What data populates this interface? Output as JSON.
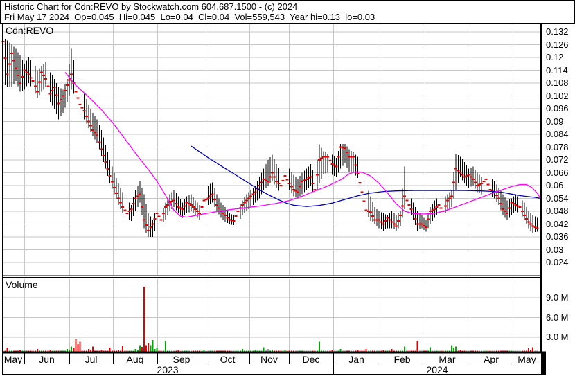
{
  "header": {
    "title": "Historic Chart for Cdn:REVO by Stockwatch.com 604.687.1500 - (c) 2024",
    "quote_line": "Fri May 17 2024  Op=0.045  Hi=0.045  Lo=0.04  Cl=0.04  Vol=559,543  Year hi=0.13  lo=0.03",
    "quote": {
      "date": "Fri May 17 2024",
      "open": "0.045",
      "high": "0.045",
      "low": "0.04",
      "close": "0.04",
      "volume": "559,543",
      "year_high": "0.13",
      "year_low": "0.03"
    }
  },
  "panes": {
    "symbol_label": "Cdn:REVO",
    "volume_label": "Volume"
  },
  "price_axis": {
    "labels": [
      "0.132",
      "0.126",
      "0.12",
      "0.114",
      "0.108",
      "0.102",
      "0.096",
      "0.09",
      "0.084",
      "0.078",
      "0.072",
      "0.066",
      "0.06",
      "0.054",
      "0.048",
      "0.042",
      "0.036",
      "0.03",
      "0.024"
    ],
    "max": 0.132,
    "step": 0.006
  },
  "volume_axis": {
    "labels": [
      "9.0 M",
      "6.0 M",
      "3.0 M"
    ],
    "values_millions": [
      9,
      6,
      3
    ]
  },
  "time_axis": {
    "months": [
      {
        "label": "May",
        "f0": 0.0,
        "f1": 0.0411
      },
      {
        "label": "Jun",
        "f0": 0.0411,
        "f1": 0.1247
      },
      {
        "label": "Jul",
        "f0": 0.1247,
        "f1": 0.2057
      },
      {
        "label": "Aug",
        "f0": 0.2057,
        "f1": 0.2879
      },
      {
        "label": "Sep",
        "f0": 0.2879,
        "f1": 0.3779
      },
      {
        "label": "Oct",
        "f0": 0.3779,
        "f1": 0.4589
      },
      {
        "label": "Nov",
        "f0": 0.4589,
        "f1": 0.5321
      },
      {
        "label": "Dec",
        "f0": 0.5321,
        "f1": 0.6144
      },
      {
        "label": "Jan",
        "f0": 0.6144,
        "f1": 0.7005
      },
      {
        "label": "Feb",
        "f0": 0.7005,
        "f1": 0.7841
      },
      {
        "label": "Mar",
        "f0": 0.7841,
        "f1": 0.8676
      },
      {
        "label": "Apr",
        "f0": 0.8676,
        "f1": 0.9473
      },
      {
        "label": "May",
        "f0": 0.9473,
        "f1": 1.0
      }
    ],
    "years": [
      {
        "label": "2023",
        "f0": 0.0,
        "f1": 0.6144
      },
      {
        "label": "2024",
        "f0": 0.6144,
        "f1": 1.0
      }
    ]
  },
  "colors": {
    "bar": "#000000",
    "close_tick": "#e80000",
    "ma_fast": "#ff00ff",
    "ma_slow": "#0000b8",
    "vol_up": "#00a800",
    "vol_down": "#e80000",
    "vol_flat": "#9c9c9c",
    "grid": "#c6c6c6",
    "text": "#000000",
    "bg": "#ffffff"
  },
  "chart_data": {
    "type": "ohlc+volume",
    "symbol": "Cdn:REVO",
    "title": "Historic Chart for Cdn:REVO",
    "period": "May 2023 - May 2024",
    "price_ylim": [
      0.024,
      0.132
    ],
    "volume_ylim_millions": [
      0,
      11.5
    ],
    "legend": "none",
    "grid": "on",
    "sampling_note": "high/low/close triplets read off the chart, one point per ~2 trading days",
    "bars_hlc": [
      [
        0.129,
        0.108,
        0.1275
      ],
      [
        0.128,
        0.106,
        0.112
      ],
      [
        0.126,
        0.106,
        0.122
      ],
      [
        0.124,
        0.109,
        0.115
      ],
      [
        0.121,
        0.104,
        0.108
      ],
      [
        0.117,
        0.105,
        0.114
      ],
      [
        0.12,
        0.108,
        0.112
      ],
      [
        0.118,
        0.105,
        0.109
      ],
      [
        0.114,
        0.101,
        0.104
      ],
      [
        0.116,
        0.104,
        0.113
      ],
      [
        0.118,
        0.106,
        0.11
      ],
      [
        0.113,
        0.099,
        0.103
      ],
      [
        0.11,
        0.096,
        0.106
      ],
      [
        0.106,
        0.091,
        0.0985
      ],
      [
        0.105,
        0.094,
        0.102
      ],
      [
        0.11,
        0.099,
        0.107
      ],
      [
        0.124,
        0.105,
        0.112
      ],
      [
        0.114,
        0.101,
        0.104
      ],
      [
        0.107,
        0.094,
        0.098
      ],
      [
        0.103,
        0.091,
        0.095
      ],
      [
        0.098,
        0.087,
        0.09
      ],
      [
        0.094,
        0.083,
        0.086
      ],
      [
        0.091,
        0.08,
        0.0835
      ],
      [
        0.086,
        0.074,
        0.077
      ],
      [
        0.079,
        0.068,
        0.071
      ],
      [
        0.072,
        0.061,
        0.0645
      ],
      [
        0.066,
        0.056,
        0.059
      ],
      [
        0.061,
        0.051,
        0.054
      ],
      [
        0.057,
        0.047,
        0.05
      ],
      [
        0.053,
        0.044,
        0.047
      ],
      [
        0.051,
        0.0435,
        0.049
      ],
      [
        0.058,
        0.048,
        0.054
      ],
      [
        0.062,
        0.052,
        0.056
      ],
      [
        0.056,
        0.04,
        0.044
      ],
      [
        0.047,
        0.036,
        0.039
      ],
      [
        0.044,
        0.036,
        0.042
      ],
      [
        0.05,
        0.042,
        0.047
      ],
      [
        0.047,
        0.0415,
        0.044
      ],
      [
        0.052,
        0.044,
        0.05
      ],
      [
        0.056,
        0.048,
        0.052
      ],
      [
        0.058,
        0.05,
        0.053
      ],
      [
        0.055,
        0.047,
        0.05
      ],
      [
        0.052,
        0.045,
        0.049
      ],
      [
        0.055,
        0.047,
        0.052
      ],
      [
        0.056,
        0.048,
        0.051
      ],
      [
        0.053,
        0.046,
        0.049
      ],
      [
        0.051,
        0.044,
        0.047
      ],
      [
        0.056,
        0.047,
        0.053
      ],
      [
        0.06,
        0.051,
        0.054
      ],
      [
        0.0615,
        0.052,
        0.056
      ],
      [
        0.056,
        0.048,
        0.051
      ],
      [
        0.052,
        0.045,
        0.048
      ],
      [
        0.05,
        0.043,
        0.046
      ],
      [
        0.047,
        0.042,
        0.044
      ],
      [
        0.046,
        0.0415,
        0.0435
      ],
      [
        0.05,
        0.043,
        0.048
      ],
      [
        0.053,
        0.046,
        0.051
      ],
      [
        0.056,
        0.048,
        0.053
      ],
      [
        0.058,
        0.05,
        0.055
      ],
      [
        0.06,
        0.052,
        0.057
      ],
      [
        0.064,
        0.054,
        0.06
      ],
      [
        0.068,
        0.058,
        0.063
      ],
      [
        0.072,
        0.06,
        0.062
      ],
      [
        0.0745,
        0.062,
        0.066
      ],
      [
        0.07,
        0.059,
        0.062
      ],
      [
        0.067,
        0.056,
        0.06
      ],
      [
        0.0695,
        0.059,
        0.0645
      ],
      [
        0.068,
        0.058,
        0.061
      ],
      [
        0.065,
        0.055,
        0.058
      ],
      [
        0.063,
        0.054,
        0.057
      ],
      [
        0.066,
        0.056,
        0.062
      ],
      [
        0.068,
        0.058,
        0.063
      ],
      [
        0.07,
        0.06,
        0.064
      ],
      [
        0.065,
        0.054,
        0.058
      ],
      [
        0.0793,
        0.061,
        0.072
      ],
      [
        0.076,
        0.0655,
        0.0735
      ],
      [
        0.075,
        0.066,
        0.0735
      ],
      [
        0.0745,
        0.065,
        0.07
      ],
      [
        0.073,
        0.064,
        0.069
      ],
      [
        0.0795,
        0.068,
        0.078
      ],
      [
        0.0795,
        0.0705,
        0.0775
      ],
      [
        0.077,
        0.0665,
        0.0735
      ],
      [
        0.0755,
        0.066,
        0.0735
      ],
      [
        0.0735,
        0.0635,
        0.0655
      ],
      [
        0.066,
        0.054,
        0.057
      ],
      [
        0.06,
        0.047,
        0.0485
      ],
      [
        0.055,
        0.0435,
        0.0475
      ],
      [
        0.05,
        0.042,
        0.044
      ],
      [
        0.048,
        0.04,
        0.044
      ],
      [
        0.047,
        0.039,
        0.042
      ],
      [
        0.046,
        0.04,
        0.045
      ],
      [
        0.048,
        0.04,
        0.043
      ],
      [
        0.046,
        0.039,
        0.041
      ],
      [
        0.048,
        0.041,
        0.046
      ],
      [
        0.069,
        0.049,
        0.055
      ],
      [
        0.056,
        0.048,
        0.051
      ],
      [
        0.052,
        0.044,
        0.047
      ],
      [
        0.048,
        0.039,
        0.042
      ],
      [
        0.046,
        0.04,
        0.042
      ],
      [
        0.044,
        0.0385,
        0.0405
      ],
      [
        0.05,
        0.042,
        0.048
      ],
      [
        0.053,
        0.045,
        0.049
      ],
      [
        0.055,
        0.047,
        0.051
      ],
      [
        0.054,
        0.046,
        0.048
      ],
      [
        0.056,
        0.048,
        0.053
      ],
      [
        0.058,
        0.05,
        0.055
      ],
      [
        0.075,
        0.058,
        0.068
      ],
      [
        0.0735,
        0.064,
        0.066
      ],
      [
        0.071,
        0.061,
        0.064
      ],
      [
        0.068,
        0.059,
        0.065
      ],
      [
        0.069,
        0.06,
        0.063
      ],
      [
        0.066,
        0.057,
        0.06
      ],
      [
        0.064,
        0.056,
        0.061
      ],
      [
        0.066,
        0.058,
        0.063
      ],
      [
        0.064,
        0.055,
        0.058
      ],
      [
        0.062,
        0.054,
        0.057
      ],
      [
        0.059,
        0.051,
        0.054
      ],
      [
        0.056,
        0.046,
        0.049
      ],
      [
        0.053,
        0.044,
        0.047
      ],
      [
        0.054,
        0.046,
        0.052
      ],
      [
        0.056,
        0.048,
        0.051
      ],
      [
        0.054,
        0.047,
        0.05
      ],
      [
        0.052,
        0.044,
        0.046
      ],
      [
        0.048,
        0.04,
        0.043
      ],
      [
        0.046,
        0.038,
        0.041
      ],
      [
        0.045,
        0.0385,
        0.04
      ]
    ],
    "volume_millions": [
      0.8,
      1.4,
      0.7,
      0.5,
      1.0,
      0.6,
      0.5,
      0.9,
      1.2,
      0.6,
      0.8,
      1.0,
      0.7,
      0.5,
      0.8,
      1.2,
      1.6,
      2.8,
      2.3,
      0.9,
      1.2,
      1.6,
      0.8,
      1.1,
      0.7,
      1.4,
      0.8,
      1.0,
      1.7,
      0.9,
      0.7,
      1.2,
      1.8,
      10.7,
      2.1,
      2.6,
      1.4,
      0.9,
      2.4,
      0.8,
      0.6,
      1.0,
      0.7,
      0.5,
      0.8,
      0.6,
      0.4,
      1.1,
      0.7,
      0.5,
      0.8,
      0.6,
      0.4,
      0.7,
      0.5,
      0.9,
      1.2,
      0.8,
      0.6,
      1.0,
      0.7,
      1.5,
      1.2,
      1.1,
      0.5,
      0.8,
      1.1,
      0.6,
      0.9,
      0.7,
      0.5,
      0.8,
      0.6,
      0.4,
      2.3,
      0.9,
      0.7,
      1.1,
      0.8,
      1.2,
      0.9,
      0.6,
      0.8,
      1.0,
      0.7,
      1.2,
      1.0,
      0.6,
      0.8,
      1.0,
      0.7,
      1.2,
      0.6,
      0.5,
      1.6,
      0.9,
      0.6,
      2.4,
      0.5,
      0.7,
      1.5,
      0.6,
      0.5,
      0.8,
      0.7,
      1.8,
      1.6,
      1.0,
      0.8,
      0.6,
      0.9,
      0.7,
      0.5,
      0.8,
      0.6,
      0.9,
      0.5,
      0.7,
      0.4,
      0.6,
      0.8,
      0.5,
      0.9,
      1.3,
      1.5,
      0.6
    ],
    "ma_fast_points": [
      [
        14.5,
        0.113
      ],
      [
        17,
        0.107
      ],
      [
        20,
        0.1015
      ],
      [
        23,
        0.0955
      ],
      [
        26,
        0.0885
      ],
      [
        29,
        0.0805
      ],
      [
        32,
        0.0725
      ],
      [
        34,
        0.0675
      ],
      [
        36,
        0.062
      ],
      [
        38,
        0.0555
      ],
      [
        40,
        0.0485
      ],
      [
        41.5,
        0.0457
      ],
      [
        43,
        0.0452
      ],
      [
        45,
        0.046
      ],
      [
        47,
        0.0468
      ],
      [
        50,
        0.0478
      ],
      [
        53,
        0.0487
      ],
      [
        57,
        0.0497
      ],
      [
        61,
        0.0507
      ],
      [
        64,
        0.0517
      ],
      [
        67,
        0.053
      ],
      [
        70,
        0.055
      ],
      [
        73,
        0.0575
      ],
      [
        76,
        0.0598
      ],
      [
        79,
        0.0627
      ],
      [
        81,
        0.0655
      ],
      [
        82.5,
        0.0665
      ],
      [
        84,
        0.0662
      ],
      [
        86,
        0.0645
      ],
      [
        88,
        0.061
      ],
      [
        90,
        0.0565
      ],
      [
        92,
        0.0515
      ],
      [
        94,
        0.048
      ],
      [
        96,
        0.0469
      ],
      [
        98.5,
        0.0467
      ],
      [
        101,
        0.047
      ],
      [
        103,
        0.048
      ],
      [
        105,
        0.0493
      ],
      [
        107,
        0.0508
      ],
      [
        109,
        0.0523
      ],
      [
        111,
        0.0538
      ],
      [
        113,
        0.0553
      ],
      [
        115,
        0.0568
      ],
      [
        117,
        0.0582
      ],
      [
        119,
        0.0595
      ],
      [
        121,
        0.0605
      ],
      [
        122.5,
        0.0605
      ],
      [
        123.8,
        0.059
      ],
      [
        125,
        0.0565
      ],
      [
        125.8,
        0.0538
      ]
    ],
    "ma_slow_points": [
      [
        44,
        0.0785
      ],
      [
        46,
        0.0758
      ],
      [
        48,
        0.073
      ],
      [
        50,
        0.0705
      ],
      [
        52,
        0.068
      ],
      [
        54,
        0.0655
      ],
      [
        56,
        0.063
      ],
      [
        58,
        0.0605
      ],
      [
        60,
        0.058
      ],
      [
        62,
        0.0558
      ],
      [
        64,
        0.0538
      ],
      [
        66,
        0.052
      ],
      [
        68,
        0.0508
      ],
      [
        71,
        0.0502
      ],
      [
        74,
        0.0507
      ],
      [
        77,
        0.0518
      ],
      [
        80,
        0.0535
      ],
      [
        83,
        0.0552
      ],
      [
        86,
        0.0565
      ],
      [
        89,
        0.0572
      ],
      [
        92,
        0.0575
      ],
      [
        96,
        0.0577
      ],
      [
        100,
        0.0577
      ],
      [
        104,
        0.0577
      ],
      [
        108,
        0.0577
      ],
      [
        112,
        0.0575
      ],
      [
        115,
        0.0572
      ],
      [
        117,
        0.0568
      ],
      [
        119,
        0.056
      ],
      [
        121,
        0.0553
      ],
      [
        123,
        0.0548
      ],
      [
        124.5,
        0.0545
      ],
      [
        125.8,
        0.054
      ]
    ]
  }
}
